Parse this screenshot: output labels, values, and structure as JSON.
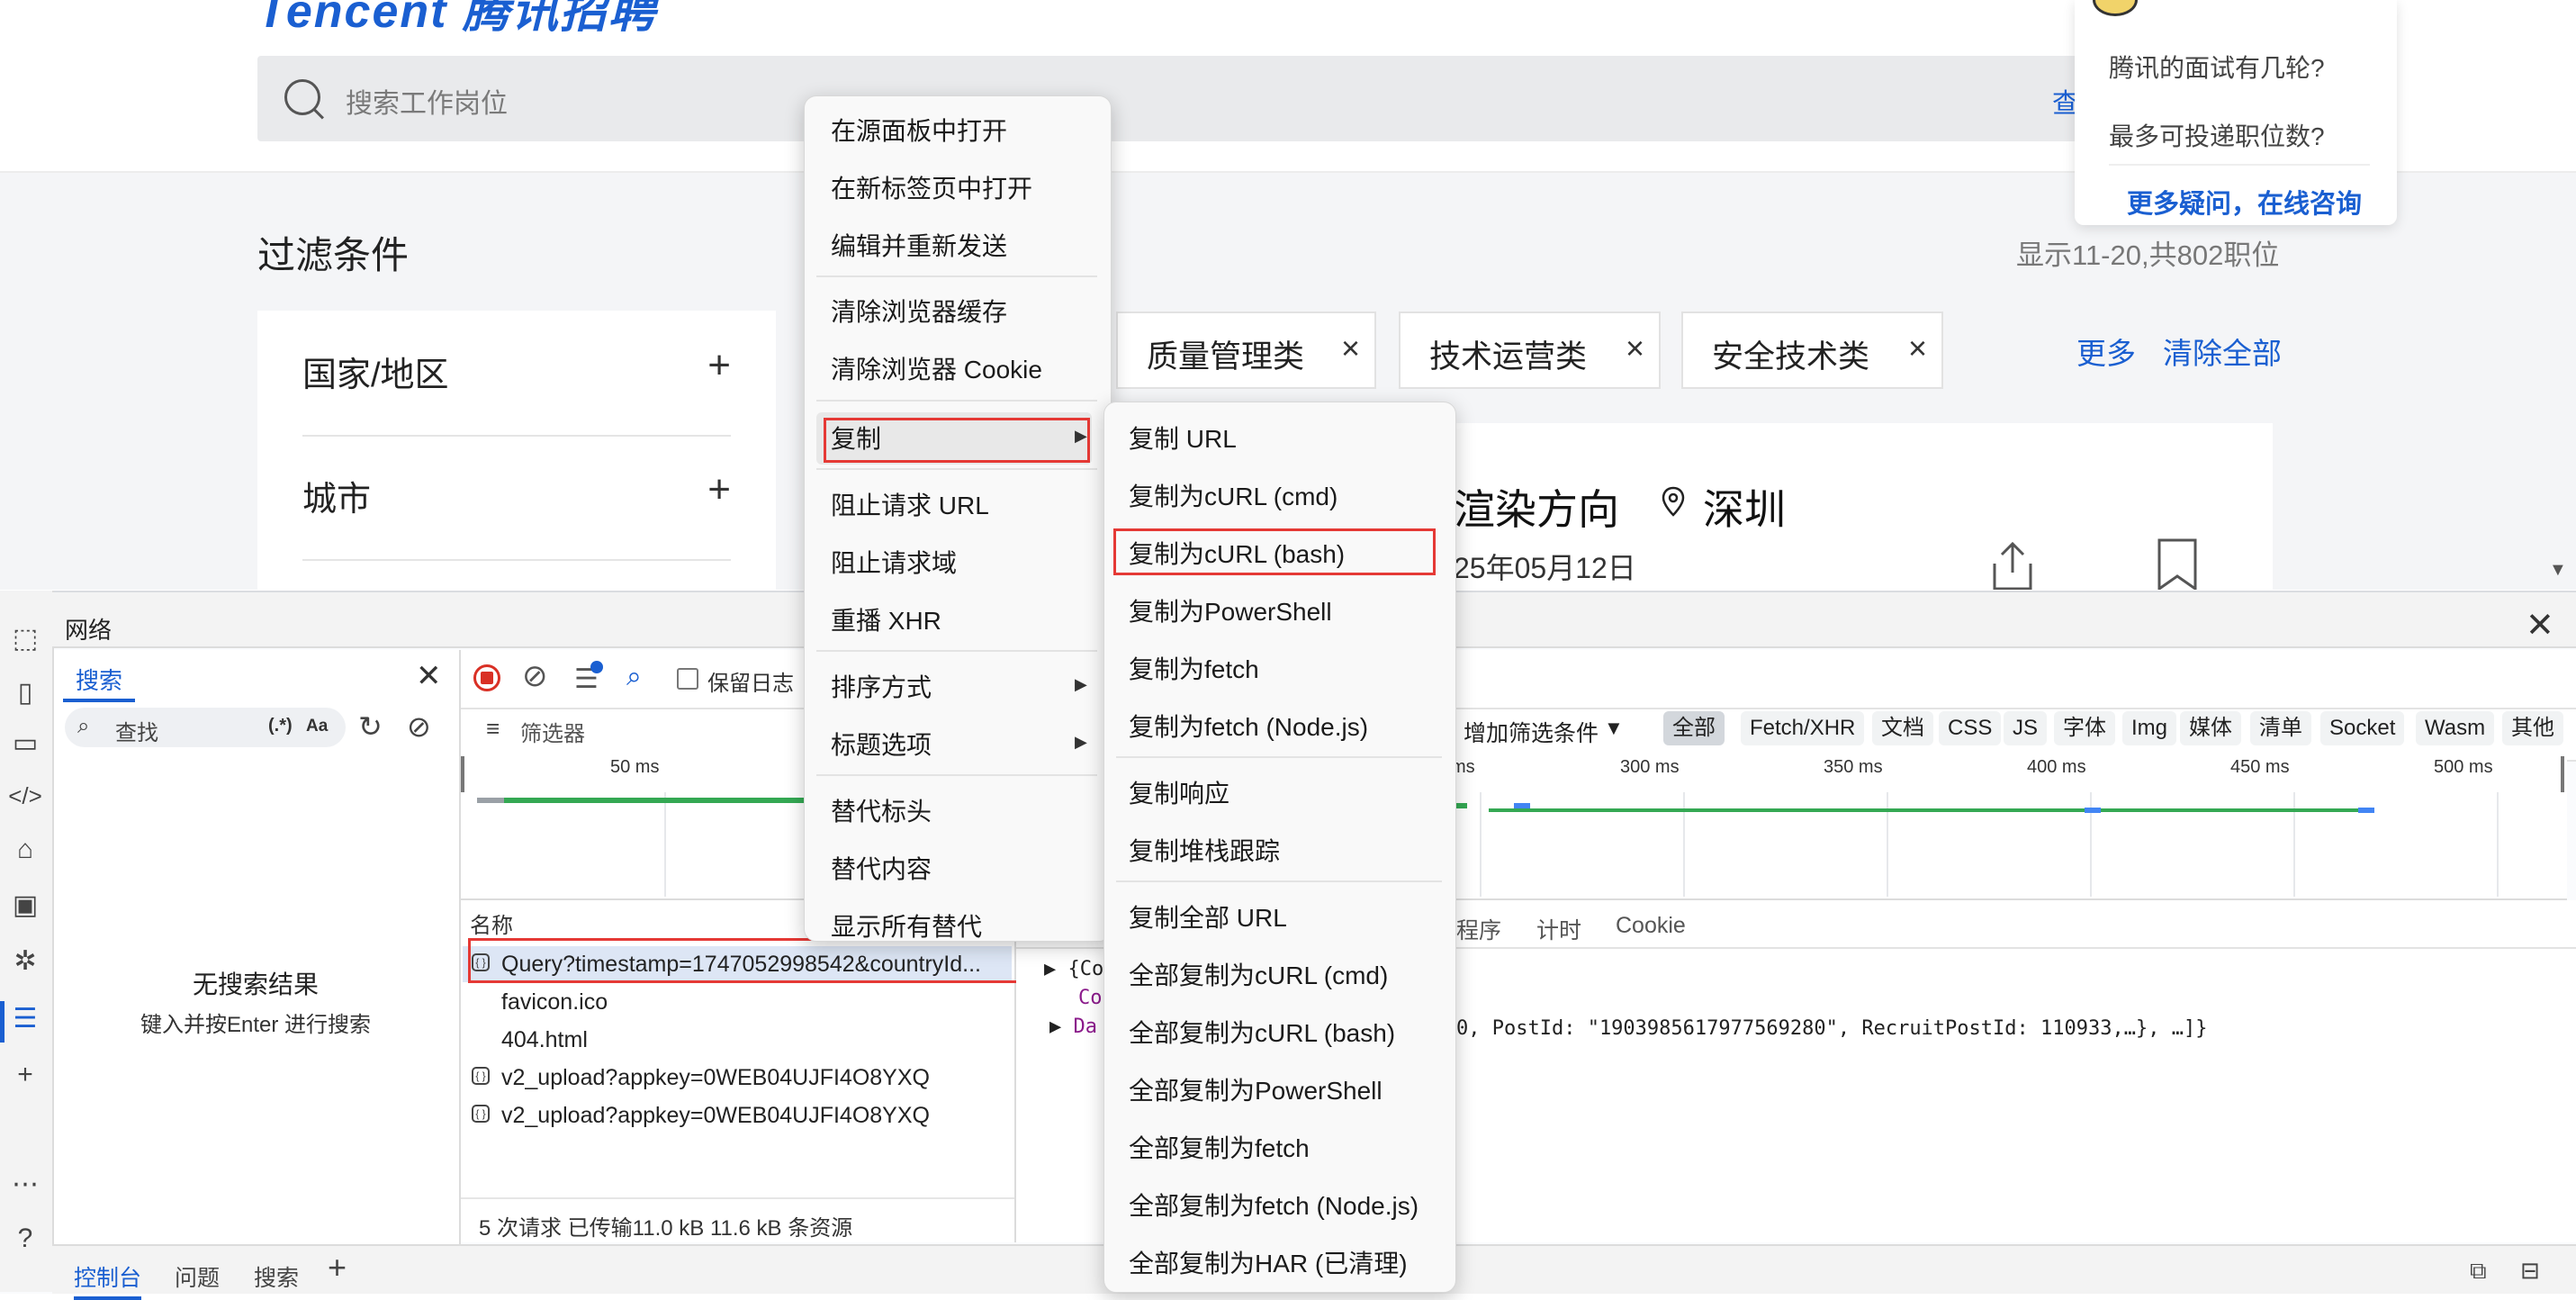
{
  "webpage": {
    "logo_fragment": "Tencent 腾讯招聘",
    "search_placeholder": "搜索工作岗位",
    "search_button_fragment": "查",
    "filter_title": "过滤条件",
    "result_count": "显示11-20,共802职位",
    "filters": [
      {
        "label": "国家/地区",
        "action": "+"
      },
      {
        "label": "城市",
        "action": "+"
      }
    ],
    "selected_tags": [
      "质量管理类",
      "技术运营类",
      "安全技术类"
    ],
    "tag_remove": "×",
    "more_label": "更多",
    "clear_all_label": "清除全部",
    "job_card": {
      "title_fragment": "渲染方向",
      "city": "深圳",
      "date_fragment": "25年05月12日"
    },
    "help": {
      "questions": [
        "腾讯的面试有几轮?",
        "最多可投递职位数?"
      ],
      "link": "更多疑问，在线咨询"
    }
  },
  "devtools": {
    "title": "网络",
    "search_panel": {
      "tab": "搜索",
      "input_placeholder": "查找",
      "regex_label": "(.*)",
      "case_label": "Aa",
      "no_results_title": "无搜索结果",
      "no_results_hint": "键入并按Enter 进行搜索"
    },
    "toolbar": {
      "preserve_log": "保留日志",
      "filter_placeholder": "筛选器",
      "add_filter": "增加筛选条件",
      "type_filters": [
        "全部",
        "Fetch/XHR",
        "文档",
        "CSS",
        "JS",
        "字体",
        "Img",
        "媒体",
        "清单",
        "Socket",
        "Wasm",
        "其他"
      ],
      "active_type": "全部"
    },
    "timeline": {
      "ticks": [
        "50 ms",
        "ms",
        "300 ms",
        "350 ms",
        "400 ms",
        "450 ms",
        "500 ms"
      ]
    },
    "requests": {
      "header": "名称",
      "rows": [
        {
          "name": "Query?timestamp=1747052998542&countryId...",
          "icon": "fetch"
        },
        {
          "name": "favicon.ico",
          "icon": ""
        },
        {
          "name": "404.html",
          "icon": ""
        },
        {
          "name": "v2_upload?appkey=0WEB04UJFI4O8YXQ",
          "icon": "fetch"
        },
        {
          "name": "v2_upload?appkey=0WEB04UJFI4O8YXQ",
          "icon": "fetch"
        }
      ],
      "summary": "5 次请求   已传输11.0 kB   11.6 kB 条资源"
    },
    "details": {
      "tabs": [
        "程序",
        "计时",
        "Cookie"
      ],
      "line1": "{Cod",
      "line2": "Co",
      "line3": "Da",
      "line3_tail": "0, PostId: \"1903985617977569280\", RecruitPostId: 110933,…}, …]}"
    },
    "drawer": {
      "tabs": [
        "控制台",
        "问题",
        "搜索"
      ],
      "add": "+"
    }
  },
  "context_menu": {
    "items": [
      "在源面板中打开",
      "在新标签页中打开",
      "编辑并重新发送",
      "清除浏览器缓存",
      "清除浏览器 Cookie",
      "复制",
      "阻止请求 URL",
      "阻止请求域",
      "重播 XHR",
      "排序方式",
      "标题选项",
      "替代标头",
      "替代内容",
      "显示所有替代"
    ]
  },
  "copy_submenu": {
    "items": [
      "复制 URL",
      "复制为cURL (cmd)",
      "复制为cURL (bash)",
      "复制为PowerShell",
      "复制为fetch",
      "复制为fetch (Node.js)",
      "复制响应",
      "复制堆栈跟踪",
      "复制全部 URL",
      "全部复制为cURL (cmd)",
      "全部复制为cURL (bash)",
      "全部复制为PowerShell",
      "全部复制为fetch",
      "全部复制为fetch (Node.js)",
      "全部复制为HAR (已清理)"
    ]
  },
  "colors": {
    "accent": "#1a5fd1",
    "highlight_red": "#e53935",
    "record_red": "#d93025",
    "timeline_green": "#34a853"
  }
}
